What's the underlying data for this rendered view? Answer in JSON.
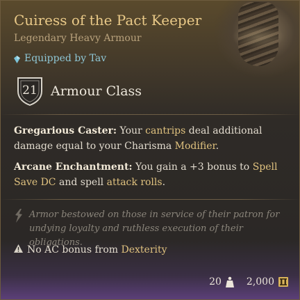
{
  "item": {
    "name": "Cuiress of the Pact Keeper",
    "rarity_type": "Legendary Heavy Armour",
    "equipped_by": "Equipped by Tav",
    "armour_class": {
      "value": "21",
      "label": "Armour Class"
    }
  },
  "properties": [
    {
      "name": "Gregarious Caster:",
      "segments": [
        {
          "text": " Your ",
          "kw": false
        },
        {
          "text": "cantrips",
          "kw": true
        },
        {
          "text": " deal additional damage equal to your Charisma ",
          "kw": false
        },
        {
          "text": "Modifier",
          "kw": true
        },
        {
          "text": ".",
          "kw": false
        }
      ]
    },
    {
      "name": "Arcane Enchantment:",
      "segments": [
        {
          "text": " You gain a +3 bonus to ",
          "kw": false
        },
        {
          "text": "Spell Save DC",
          "kw": true
        },
        {
          "text": " and spell ",
          "kw": false
        },
        {
          "text": "attack rolls",
          "kw": true
        },
        {
          "text": ".",
          "kw": false
        }
      ]
    }
  ],
  "flavor_text": "Armor bestowed on those in service of their patron for undying loyalty and ruthless execution of their obligations.",
  "warning": {
    "prefix": "No AC bonus from ",
    "keyword": "Dexterity"
  },
  "footer": {
    "weight": "20",
    "value": "2,000"
  },
  "colors": {
    "title": "#e9c988",
    "keyword": "#e0c27f",
    "equipped": "#8fc7d6",
    "flavor": "#8b857b",
    "legendary_glow": "#5b3f78"
  },
  "icons": {
    "equipped": "gem-icon",
    "ac": "shield-icon",
    "flavor": "lightning-icon",
    "warning": "warning-triangle-icon",
    "weight": "weight-icon",
    "value": "gold-coin-icon"
  }
}
